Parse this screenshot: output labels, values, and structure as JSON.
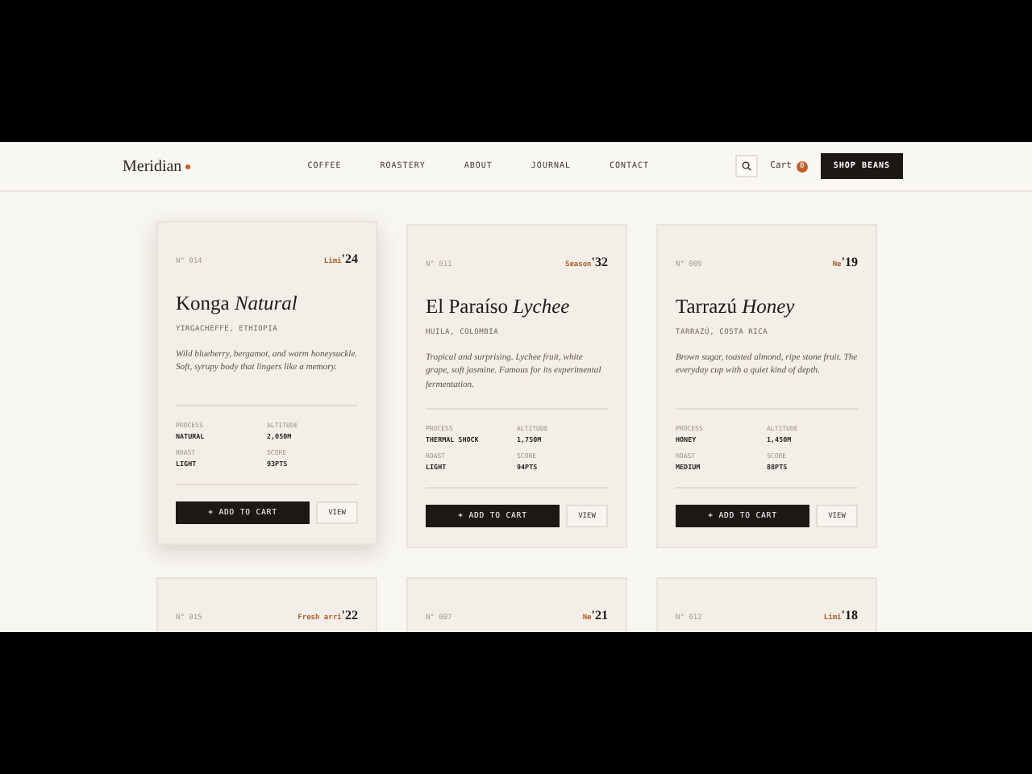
{
  "header": {
    "logo": "Meridian",
    "nav": [
      {
        "label": "COFFEE"
      },
      {
        "label": "ROASTERY"
      },
      {
        "label": "ABOUT"
      },
      {
        "label": "JOURNAL"
      },
      {
        "label": "CONTACT"
      }
    ],
    "cart": {
      "label": "Cart",
      "count": "0"
    },
    "shop_button": "SHOP BEANS"
  },
  "cards": [
    {
      "number": "N° 014",
      "tag": "Limi",
      "year": "'24",
      "name": "Konga *Natural*",
      "origin": "YIRGACHEFFE, ETHIOPIA",
      "description": "Wild blueberry, bergamot, and warm honeysuckle. Soft, syrupy body that lingers like a memory.",
      "specs": [
        {
          "label": "PROCESS",
          "value": "NATURAL"
        },
        {
          "label": "ALTITUDE",
          "value": "2,050M"
        },
        {
          "label": "ROAST",
          "value": "LIGHT"
        },
        {
          "label": "SCORE",
          "value": "93PTS"
        }
      ],
      "add_button": "+ ADD TO CART",
      "view_button": "VIEW",
      "hovered": true
    },
    {
      "number": "N° 011",
      "tag": "Season",
      "year": "'32",
      "name": "El Paraíso *Lychee*",
      "origin": "HUILA, COLOMBIA",
      "description": "Tropical and surprising. Lychee fruit, white grape, soft jasmine. Famous for its experimental fermentation.",
      "specs": [
        {
          "label": "PROCESS",
          "value": "THERMAL SHOCK"
        },
        {
          "label": "ALTITUDE",
          "value": "1,750M"
        },
        {
          "label": "ROAST",
          "value": "LIGHT"
        },
        {
          "label": "SCORE",
          "value": "94PTS"
        }
      ],
      "add_button": "+ ADD TO CART",
      "view_button": "VIEW",
      "hovered": false
    },
    {
      "number": "N° 009",
      "tag": "Ne",
      "year": "'19",
      "name": "Tarrazú *Honey*",
      "origin": "TARRAZÚ, COSTA RICA",
      "description": "Brown sugar, toasted almond, ripe stone fruit. The everyday cup with a quiet kind of depth.",
      "specs": [
        {
          "label": "PROCESS",
          "value": "HONEY"
        },
        {
          "label": "ALTITUDE",
          "value": "1,450M"
        },
        {
          "label": "ROAST",
          "value": "MEDIUM"
        },
        {
          "label": "SCORE",
          "value": "88PTS"
        }
      ],
      "add_button": "+ ADD TO CART",
      "view_button": "VIEW",
      "hovered": false
    },
    {
      "number": "N° 015",
      "tag": "Fresh arri",
      "year": "'22",
      "hovered": false
    },
    {
      "number": "N° 007",
      "tag": "Ne",
      "year": "'21",
      "hovered": false
    },
    {
      "number": "N° 012",
      "tag": "Limi",
      "year": "'18",
      "hovered": false
    }
  ]
}
